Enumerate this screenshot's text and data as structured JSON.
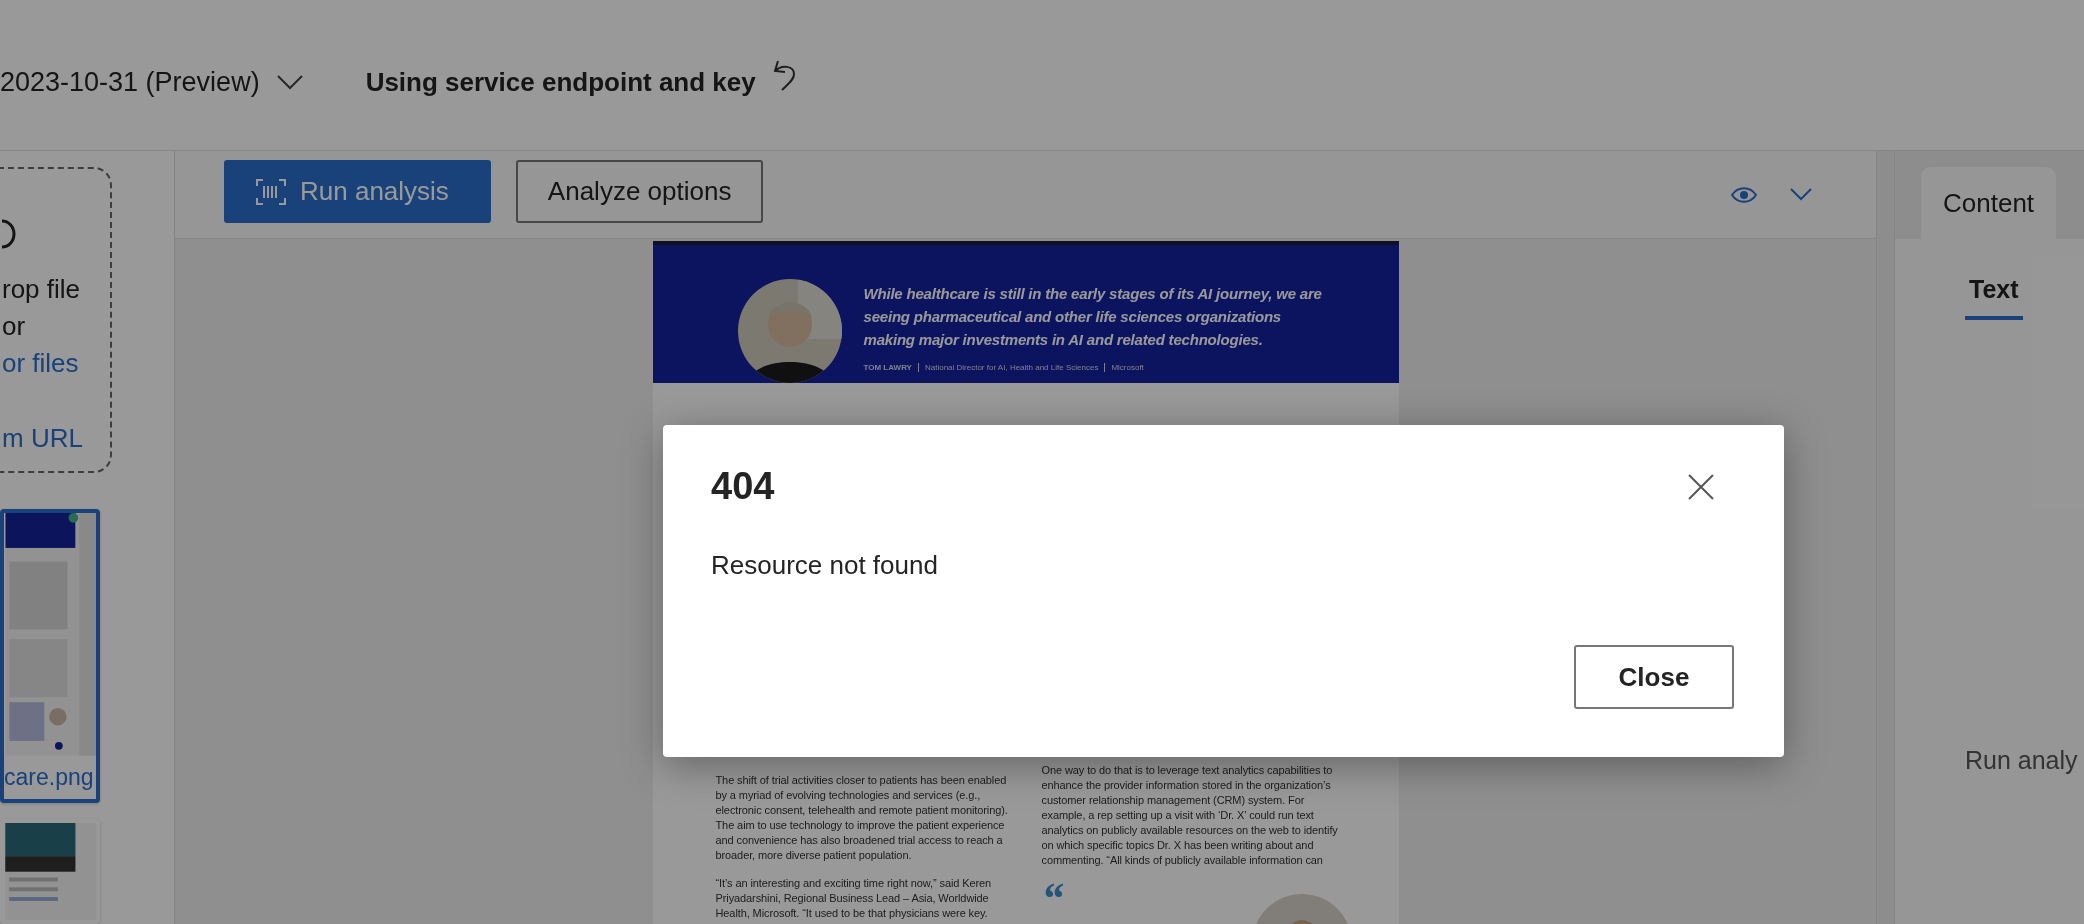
{
  "header": {
    "api_version": "2023-10-31 (Preview)",
    "auth_mode": "Using service endpoint and key"
  },
  "sidebar": {
    "drop_zone": {
      "line_1": "rop file",
      "line_2": "or",
      "browse_link": "or files",
      "url_link": "m URL"
    },
    "files": [
      {
        "kind": "picture",
        "name": "care.png",
        "selected": true
      },
      {
        "kind": "picture",
        "selected": false
      }
    ]
  },
  "toolbar": {
    "buttons": [
      {
        "label": "Run analysis",
        "kind": "primary"
      },
      {
        "label": "Analyze options",
        "kind": "secondary"
      }
    ]
  },
  "document": {
    "banner": {
      "quote": "While healthcare is still in the early stages of its AI journey, we are seeing pharmaceutical and other life sciences organizations making major investments in AI and related technologies.",
      "speaker": "TOM LAWRY",
      "role": "National Director for AI, Health and Life Sciences",
      "company": "Microsoft"
    },
    "columns": [
      {
        "paragraphs": [
          "The shift of trial activities closer to patients has been enabled by a myriad of evolving technologies and services (e.g., electronic consent, telehealth and remote patient monitoring). The aim to use technology to improve the patient experience and convenience has also broadened trial access to reach a broader, more diverse patient population.",
          "“It’s an interesting and exciting time right now,” said Keren Priyadarshini, Regional Business Lead – Asia, Worldwide Health, Microsoft. “It used to be that physicians were key."
        ]
      },
      {
        "paragraphs": [
          "One way to do that is to leverage text analytics capabilities to enhance the provider information stored in the organization’s customer relationship management (CRM) system. For example, a rep setting up a visit with ‘Dr. X’ could run text analytics on publicly available resources on the web to identify on which specific topics Dr. X has been writing about and commenting. “All kinds of publicly available information can"
        ],
        "quote_mark": "“"
      }
    ]
  },
  "results": {
    "tabs": [
      {
        "label": "Content",
        "selected": true
      }
    ],
    "pivots": [
      {
        "label": "Text",
        "selected": true
      }
    ],
    "empty_message": "Run analy"
  },
  "dialog": {
    "title": "404",
    "message": "Resource not found",
    "buttons": [
      "Close"
    ]
  }
}
